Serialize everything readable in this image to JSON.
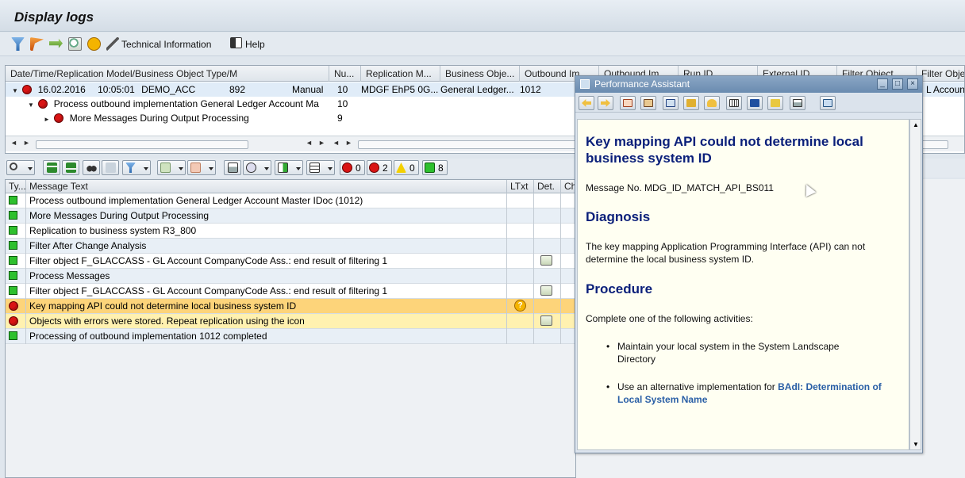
{
  "window": {
    "title": "Display logs"
  },
  "app_toolbar": {
    "technical_info_label": "Technical Information",
    "help_label": "Help"
  },
  "tree": {
    "columns": [
      "Date/Time/Replication Model/Business Object Type/M",
      "Nu...",
      "Replication M...",
      "Business Obje...",
      "Outbound Im...",
      "Outbound Im...",
      "Run ID",
      "External ID",
      "Filter Object",
      "Filter Obje"
    ],
    "row1": {
      "date": "16.02.2016",
      "time": "10:05:01",
      "model": "DEMO_ACC",
      "type": "892",
      "mode": "Manual",
      "num": "10",
      "replication": "MDGF EhP5 0G...",
      "business_object": "General Ledger...",
      "outbound": "1012",
      "last_col": "L Account"
    },
    "row2": {
      "text": "Process outbound implementation General Ledger Account Ma",
      "num": "10"
    },
    "row3": {
      "text": "More Messages During Output Processing",
      "num": "9"
    }
  },
  "log_toolbar": {
    "stop_count": "0",
    "error_count": "2",
    "warning_count": "0",
    "success_count": "8"
  },
  "log": {
    "columns": {
      "type": "Ty...",
      "text": "Message Text",
      "ltxt": "LTxt",
      "det": "Det.",
      "ch": "Ch"
    },
    "rows": [
      {
        "text": "Process outbound implementation General Ledger Account Master IDoc (1012)"
      },
      {
        "text": "More Messages During Output Processing"
      },
      {
        "text": "Replication to business system R3_800"
      },
      {
        "text": "Filter After Change Analysis"
      },
      {
        "text": "Filter object F_GLACCASS - GL Account CompanyCode Ass.: end result of filtering 1"
      },
      {
        "text": "Process Messages"
      },
      {
        "text": "Filter object F_GLACCASS - GL Account CompanyCode Ass.: end result of filtering 1"
      },
      {
        "text": "Key mapping API could not determine local business system ID"
      },
      {
        "text": "Objects with errors were stored. Repeat replication using the icon"
      },
      {
        "text": "Processing of outbound implementation 1012 completed"
      }
    ]
  },
  "assistant": {
    "title": "Performance Assistant",
    "heading": "Key mapping API could not determine local business system ID",
    "message_no": "Message No. MDG_ID_MATCH_API_BS011",
    "diagnosis_heading": "Diagnosis",
    "diagnosis_text": "The key mapping Application Programming Interface (API) can not determine the local business system ID.",
    "procedure_heading": "Procedure",
    "procedure_intro": "Complete one of the following activities:",
    "bullet1": "Maintain your local system in the System Landscape Directory",
    "bullet2_prefix": "Use an alternative implementation for",
    "bullet2_link": "BAdI: Determination of Local System Name"
  },
  "colors": {
    "error_row": "#fdd47a",
    "error_row_light": "#fff1b0",
    "heading_blue": "#0a1f7a",
    "link_blue": "#2a5fa6"
  }
}
